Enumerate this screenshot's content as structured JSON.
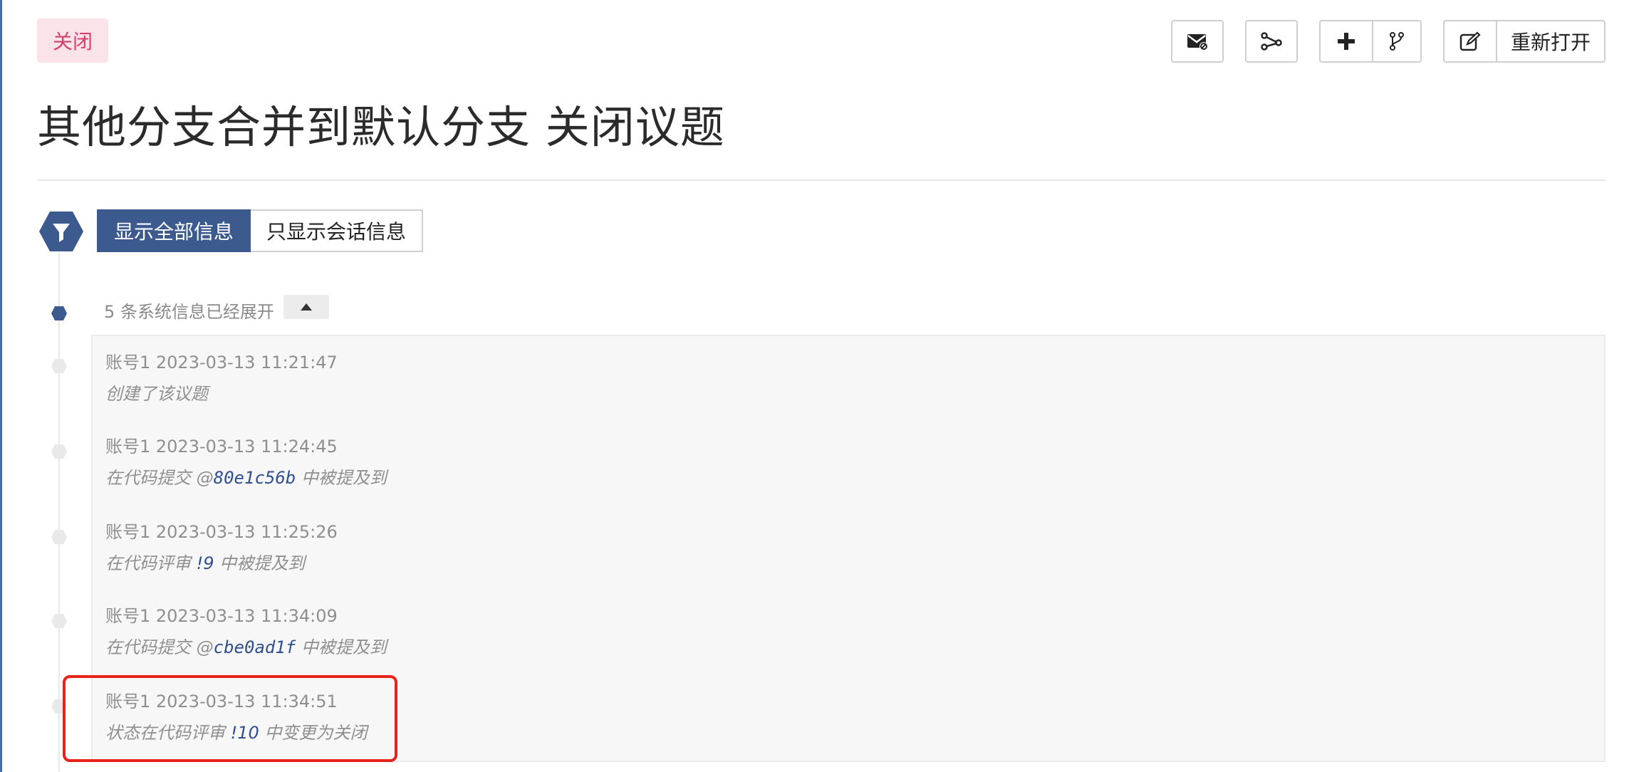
{
  "issue": {
    "status": "关闭",
    "title": "其他分支合并到默认分支 关闭议题"
  },
  "toolbar": {
    "reopen_label": "重新打开",
    "icons": [
      "envelope-icon",
      "graph-icon",
      "plus-icon",
      "branch-icon",
      "edit-icon"
    ]
  },
  "filters": {
    "show_all": "显示全部信息",
    "show_conversation": "只显示会话信息"
  },
  "timeline": {
    "collapsed_label": "5 条系统信息已经展开",
    "events": [
      {
        "meta": "账号1 2023-03-13 11:21:47",
        "prefix": "创建了该议题",
        "ref": "",
        "suffix": ""
      },
      {
        "meta": "账号1 2023-03-13 11:24:45",
        "prefix": "在代码提交 @",
        "ref": "80e1c56b",
        "suffix": " 中被提及到"
      },
      {
        "meta": "账号1 2023-03-13 11:25:26",
        "prefix": "在代码评审 ",
        "ref": "!9",
        "suffix": " 中被提及到"
      },
      {
        "meta": "账号1 2023-03-13 11:34:09",
        "prefix": "在代码提交 @",
        "ref": "cbe0ad1f",
        "suffix": " 中被提及到"
      },
      {
        "meta": "账号1 2023-03-13 11:34:51",
        "prefix": "状态在代码评审 ",
        "ref": "!10",
        "suffix": " 中变更为关闭"
      }
    ]
  },
  "colors": {
    "accent": "#3d5a8f",
    "status_bg": "#fbe3ea",
    "status_text": "#d6406a",
    "highlight": "#e8231b"
  }
}
